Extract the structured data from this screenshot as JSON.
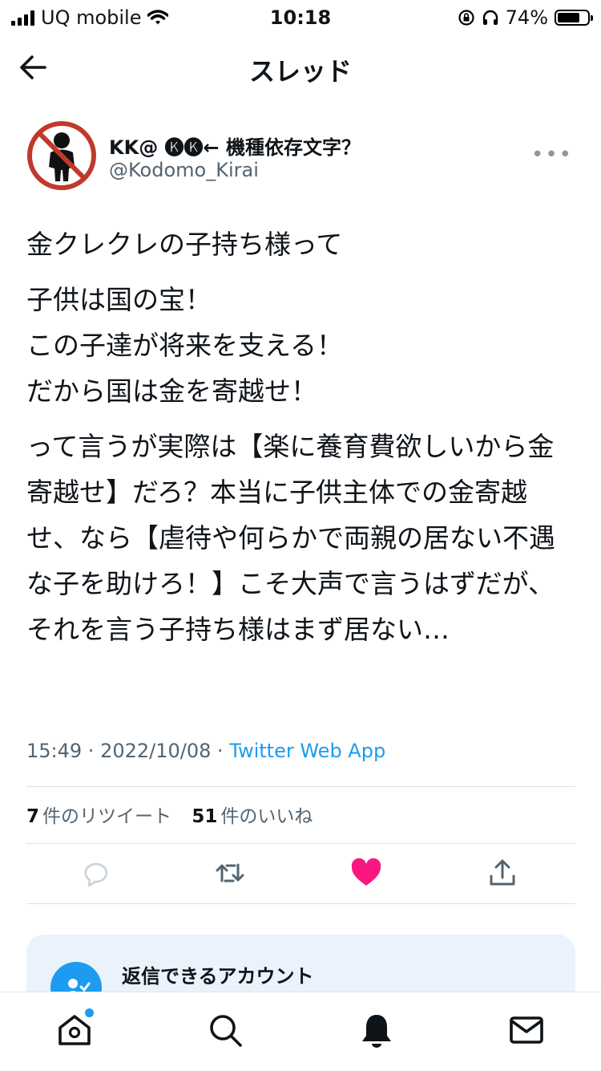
{
  "status_bar": {
    "carrier": "UQ mobile",
    "time": "10:18",
    "battery_percent": "74%",
    "battery_level": 0.74
  },
  "nav": {
    "title": "スレッド",
    "back_icon": "back-arrow-icon"
  },
  "tweet": {
    "author_name": "KK@ 🅚🅚← 機種依存文字？",
    "author_handle": "@Kodomo_Kirai",
    "paragraphs": [
      "金クレクレの子持ち様って",
      "子供は国の宝！\nこの子達が将来を支える！\nだから国は金を寄越せ！",
      "って言うが実際は【楽に養育費欲しいから金寄越せ】だろ？本当に子供主体での金寄越せ、なら【虐待や何らかで両親の居ない不遇な子を助けろ！】こそ大声で言うはずだが、それを言う子持ち様はまず居ない…"
    ],
    "time": "15:49",
    "date": "2022/10/08",
    "source": "Twitter Web App",
    "retweet_count": "7",
    "retweet_label": "件のリツイート",
    "like_count": "51",
    "like_label": "件のいいね",
    "liked": true
  },
  "reply_card": {
    "title": "返信できるアカウント"
  },
  "tabs": [
    "home-icon",
    "search-icon",
    "notifications-icon",
    "messages-icon"
  ],
  "colors": {
    "accent": "#1d9bf0",
    "like": "#f91880",
    "text": "#0f1419",
    "secondary": "#536471",
    "card_bg": "#eaf3fb"
  }
}
